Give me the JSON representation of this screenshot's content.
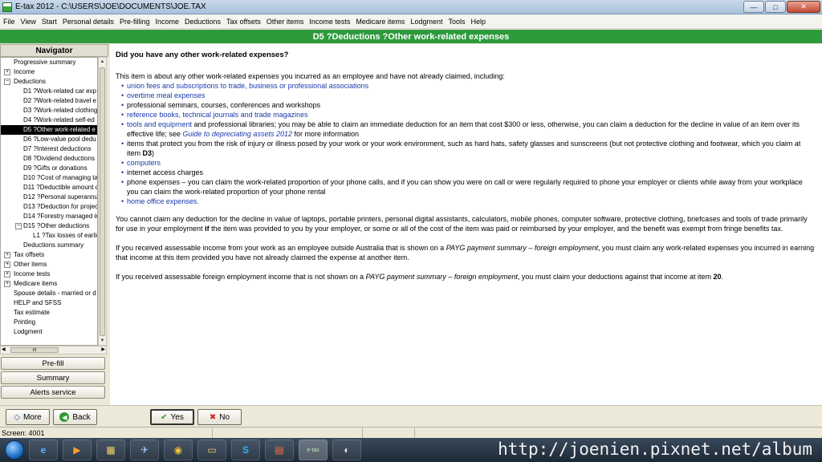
{
  "window": {
    "title": "E-tax 2012 - C:\\USERS\\JOE\\DOCUMENTS\\JOE.TAX",
    "minimize_glyph": "—",
    "maximize_glyph": "□",
    "close_glyph": "✕"
  },
  "menu": [
    "File",
    "View",
    "Start",
    "Personal details",
    "Pre-filling",
    "Income",
    "Deductions",
    "Tax offsets",
    "Other items",
    "Income tests",
    "Medicare items",
    "Lodgment",
    "Tools",
    "Help"
  ],
  "header": {
    "title": "D5 ?Deductions ?Other work-related expenses"
  },
  "navigator": {
    "title": "Navigator",
    "items": [
      {
        "label": "Progressive summary",
        "indent": 0,
        "expander": ""
      },
      {
        "label": "Income",
        "indent": 0,
        "expander": "+"
      },
      {
        "label": "Deductions",
        "indent": 0,
        "expander": "−"
      },
      {
        "label": "D1 ?Work-related car exp",
        "indent": 2,
        "expander": ""
      },
      {
        "label": "D2 ?Work-related travel e",
        "indent": 2,
        "expander": ""
      },
      {
        "label": "D3 ?Work-related clothing",
        "indent": 2,
        "expander": ""
      },
      {
        "label": "D4 ?Work-related self-ed",
        "indent": 2,
        "expander": ""
      },
      {
        "label": "D5 ?Other work-related e",
        "indent": 2,
        "expander": "",
        "selected": true
      },
      {
        "label": "D6 ?Low-value pool dedu",
        "indent": 2,
        "expander": ""
      },
      {
        "label": "D7 ?Interest deductions",
        "indent": 2,
        "expander": ""
      },
      {
        "label": "D8 ?Dividend deductions",
        "indent": 2,
        "expander": ""
      },
      {
        "label": "D9 ?Gifts or donations",
        "indent": 2,
        "expander": ""
      },
      {
        "label": "D10 ?Cost of managing tax",
        "indent": 2,
        "expander": ""
      },
      {
        "label": "D11 ?Deductible amount of",
        "indent": 2,
        "expander": ""
      },
      {
        "label": "D12 ?Personal superannua",
        "indent": 2,
        "expander": ""
      },
      {
        "label": "D13 ?Deduction for project",
        "indent": 2,
        "expander": ""
      },
      {
        "label": "D14 ?Forestry managed in",
        "indent": 2,
        "expander": ""
      },
      {
        "label": "D15 ?Other deductions",
        "indent": 2,
        "expander": "−"
      },
      {
        "label": "L1 ?Tax losses of earlier",
        "indent": 3,
        "expander": ""
      },
      {
        "label": "Deductions summary",
        "indent": 2,
        "expander": ""
      },
      {
        "label": "Tax offsets",
        "indent": 0,
        "expander": "+"
      },
      {
        "label": "Other items",
        "indent": 0,
        "expander": "+"
      },
      {
        "label": "Income tests",
        "indent": 0,
        "expander": "+"
      },
      {
        "label": "Medicare items",
        "indent": 0,
        "expander": "+"
      },
      {
        "label": "Spouse details - married or d",
        "indent": 0,
        "expander": ""
      },
      {
        "label": "HELP and SFSS",
        "indent": 0,
        "expander": ""
      },
      {
        "label": "Tax estimate",
        "indent": 0,
        "expander": ""
      },
      {
        "label": "Printing",
        "indent": 0,
        "expander": ""
      },
      {
        "label": "Lodgment",
        "indent": 0,
        "expander": ""
      }
    ],
    "hscroll_grip": "III",
    "buttons": [
      "Pre-fill",
      "Summary",
      "Alerts service"
    ]
  },
  "content": {
    "question": "Did you have any other work-related expenses?",
    "intro": "This item is about any other work-related expenses you incurred as an employee and have not already claimed, including:",
    "bullets": {
      "b1": "union fees and subscriptions to trade, business or professional associations",
      "b2": "overtime meal expenses",
      "b3": "professional seminars, courses, conferences and workshops",
      "b4": "reference books, technical journals and trade magazines",
      "b5_link": "tools and equipment",
      "b5_text": " and professional libraries; you may be able to claim an immediate deduction for an item that cost $300 or less, otherwise, you can claim a deduction for the decline in value of an item over its effective life; see ",
      "b5_guide": "Guide to depreciating assets 2012",
      "b5_end": " for more information",
      "b6_text": "items that protect you from the risk of injury or illness posed by your work or your work environment, such as hard hats, safety glasses and sunscreens (but not protective clothing and footwear, which you claim at item ",
      "b6_bold": "D3",
      "b6_end": ")",
      "b7": "computers",
      "b8": "internet access charges",
      "b9": "phone expenses – you can claim the work-related proportion of your phone calls, and if you can show you were on call or were regularly required to phone your employer or clients while away from your workplace you can claim the work-related proportion of your phone rental",
      "b10": "home office expenses."
    },
    "para1_a": "You cannot claim any deduction for the decline in value of laptops, portable printers, personal digital assistants, calculators, mobile phones, computer software, protective clothing, briefcases and tools of trade primarily for use in your employment ",
    "para1_bold": "if",
    "para1_b": " the item was provided to you by your employer, or some or all of the cost of the item was paid or reimbursed by your employer, and the benefit was exempt from fringe benefits tax.",
    "para2_a": "If you received assessable income from your work as an employee outside Australia that is shown on a ",
    "para2_italic": "PAYG payment summary – foreign employment",
    "para2_b": ", you must claim any work-related expenses you incurred in earning that income at this item provided you have not already claimed the expense at another item.",
    "para3_a": "If you received assessable foreign employment income that is not shown on a ",
    "para3_italic": "PAYG payment summary – foreign employment",
    "para3_b": ", you must claim your deductions against that income at item ",
    "para3_bold": "20",
    "para3_end": "."
  },
  "bottom_buttons": {
    "more": "More",
    "back": "Back",
    "yes": "Yes",
    "no": "No"
  },
  "status": {
    "screen": "Screen: 4001"
  },
  "taskbar": {
    "watermark": "http://joenien.pixnet.net/album",
    "etax_label": "e-tax"
  },
  "colors": {
    "header_green": "#2e9a3c",
    "link_blue": "#1a3aaa",
    "selection": "#000000"
  }
}
